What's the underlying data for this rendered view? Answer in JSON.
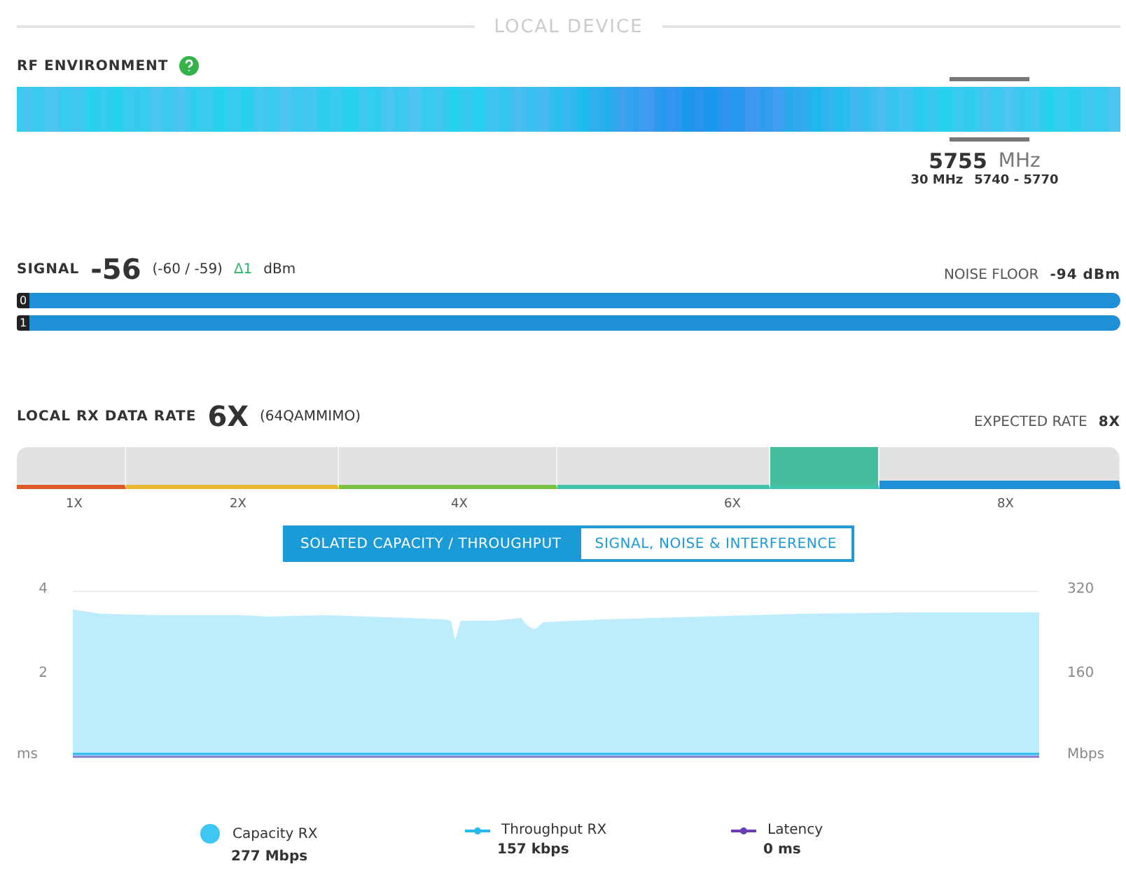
{
  "section_title": "LOCAL DEVICE",
  "rf_environment": {
    "label": "RF ENVIRONMENT",
    "frequency": "5755",
    "unit": "MHz",
    "width": "30 MHz",
    "range": "5740 - 5770"
  },
  "signal": {
    "label": "SIGNAL",
    "value": "-56",
    "range": "(-60 / -59)",
    "delta": "Δ1",
    "unit": "dBm",
    "noise_label": "NOISE FLOOR",
    "noise_value": "-94 dBm",
    "chains": [
      {
        "label": "0",
        "level": 1
      },
      {
        "label": "1",
        "level": 1
      }
    ]
  },
  "rate": {
    "label": "LOCAL RX DATA RATE",
    "value": "6X",
    "modulation": "(64QAMMIMO)",
    "expected_label": "EXPECTED RATE",
    "expected_value": "8X",
    "segments": [
      {
        "color": "#e0572a",
        "selected": false
      },
      {
        "color": "#e8b630",
        "selected": false
      },
      {
        "color": "#7cc242",
        "selected": false
      },
      {
        "color": "#3fc4a8",
        "selected": false
      },
      {
        "color": "#3fc4a8",
        "selected": true
      },
      {
        "color": "#1f8fd6",
        "selected": false
      }
    ],
    "labels": [
      "1X",
      "2X",
      "4X",
      "6X",
      "8X"
    ]
  },
  "tabs": [
    {
      "label": "SOLATED CAPACITY / THROUGHPUT",
      "selected": true
    },
    {
      "label": "SIGNAL, NOISE & INTERFERENCE",
      "selected": false
    }
  ],
  "chart": {
    "left_ticks": [
      "4",
      "2"
    ],
    "left_unit": "ms",
    "right_ticks": [
      "320",
      "160"
    ],
    "right_unit": "Mbps"
  },
  "legend": [
    {
      "name": "Capacity RX",
      "value": "277 Mbps",
      "kind": "area",
      "color": "#3ec6f5"
    },
    {
      "name": "Throughput RX",
      "value": "157 kbps",
      "kind": "line",
      "color": "#2ab8f0"
    },
    {
      "name": "Latency",
      "value": "0 ms",
      "kind": "line",
      "color": "#6a3db5"
    }
  ]
}
